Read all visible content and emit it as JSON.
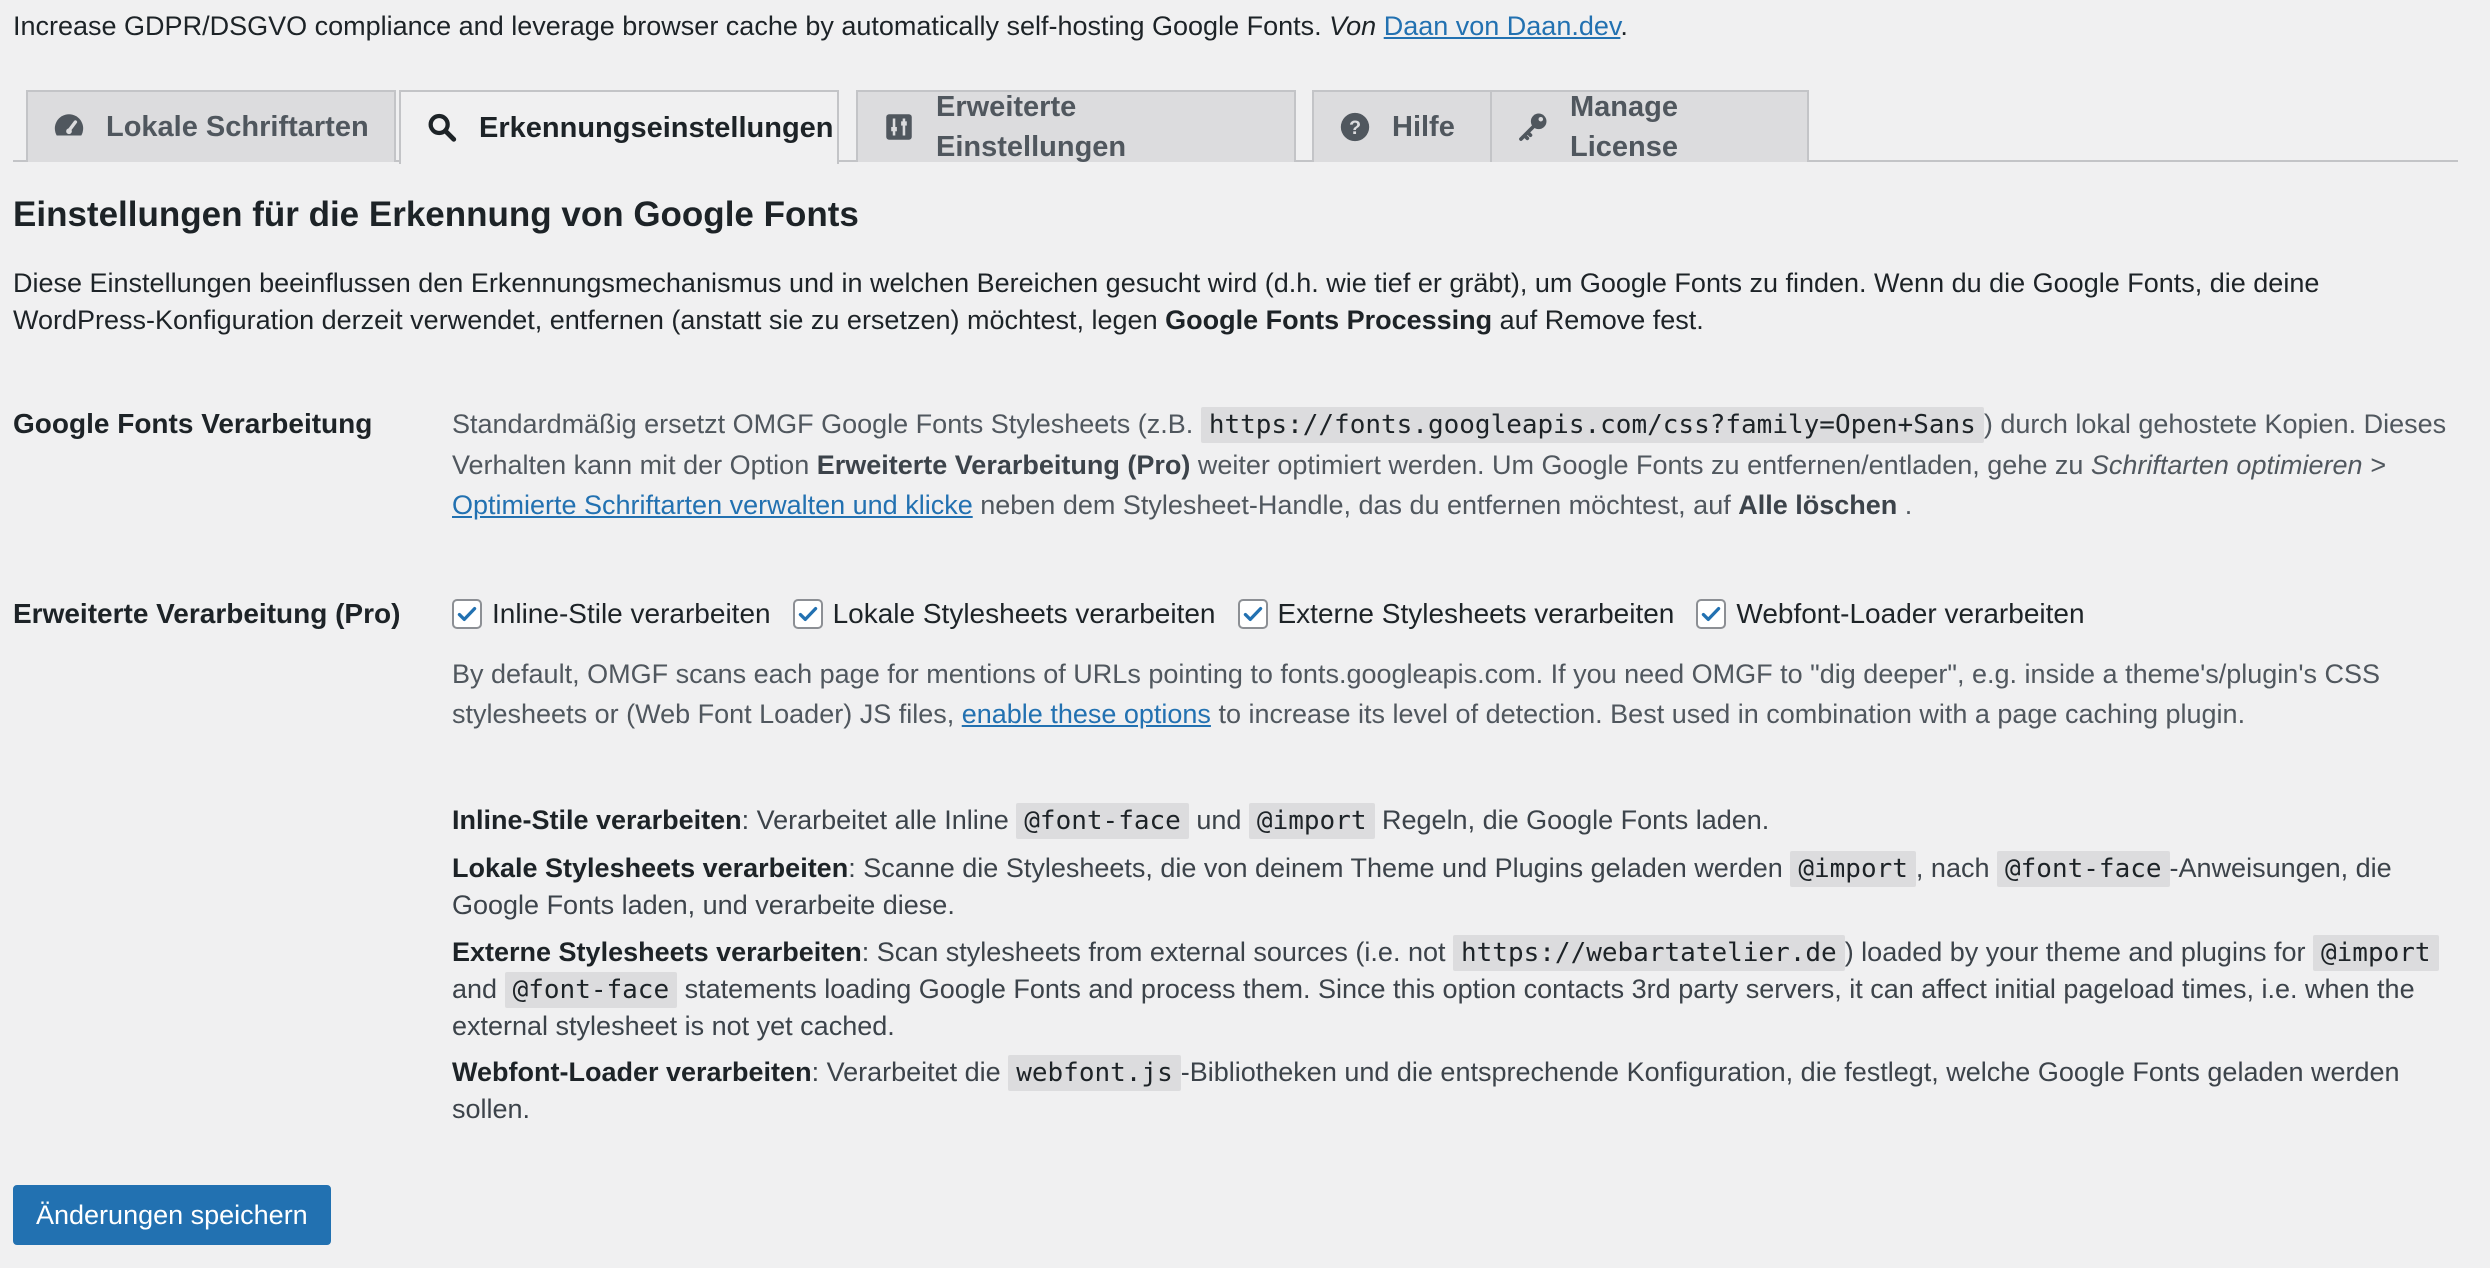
{
  "intro": {
    "text": "Increase GDPR/DSGVO compliance and leverage browser cache by automatically self-hosting Google Fonts.",
    "by": "Von",
    "author_link": "Daan von Daan.dev",
    "end": "."
  },
  "tabs": [
    {
      "label": "Lokale Schriftarten",
      "icon": "dashboard-icon",
      "active": false
    },
    {
      "label": "Erkennungseinstellungen",
      "icon": "search-icon",
      "active": true
    },
    {
      "label": "Erweiterte Einstellungen",
      "icon": "sliders-icon",
      "active": false
    },
    {
      "label": "Hilfe",
      "icon": "help-icon",
      "active": false
    },
    {
      "label": "Manage License",
      "icon": "key-icon",
      "active": false
    }
  ],
  "section": {
    "title": "Einstellungen für die Erkennung von Google Fonts",
    "desc_1": "Diese Einstellungen beeinflussen den Erkennungsmechanismus und in welchen Bereichen gesucht wird (d.h. wie tief er gräbt), um Google Fonts zu finden. Wenn du die Google Fonts, die deine WordPress-Konfiguration derzeit verwendet, entfernen (anstatt sie zu ersetzen) möchtest, legen",
    "desc_bold": "Google Fonts Processing",
    "desc_2": "auf Remove fest."
  },
  "gf_processing": {
    "label": "Google Fonts Verarbeitung",
    "t1": "Standardmäßig ersetzt OMGF Google Fonts Stylesheets (z.B.",
    "code": "https://fonts.googleapis.com/css?family=Open+Sans",
    "t2": ") durch lokal gehostete Kopien. Dieses Verhalten kann mit der Option",
    "b1": "Erweiterte Verarbeitung (Pro)",
    "t3": "weiter optimiert werden. Um Google Fonts zu entfernen/entladen, gehe zu",
    "i1": "Schriftarten optimieren >",
    "link": "Optimierte Schriftarten verwalten und klicke",
    "t4": "neben dem Stylesheet-Handle, das du entfernen möchtest, auf",
    "b2": "Alle löschen",
    "t5": "."
  },
  "advanced": {
    "label": "Erweiterte Verarbeitung (Pro)",
    "checkboxes": [
      {
        "label": "Inline-Stile verarbeiten",
        "checked": true
      },
      {
        "label": "Lokale Stylesheets verarbeiten",
        "checked": true
      },
      {
        "label": "Externe Stylesheets verarbeiten",
        "checked": true
      },
      {
        "label": "Webfont-Loader verarbeiten",
        "checked": true
      }
    ],
    "desc_1": "By default, OMGF scans each page for mentions of URLs pointing to fonts.googleapis.com. If you need OMGF to \"dig deeper\", e.g. inside a theme's/plugin's CSS stylesheets or (Web Font Loader) JS files,",
    "desc_link": "enable these options",
    "desc_2": "to increase its level of detection. Best used in combination with a page caching plugin.",
    "opt_inline": {
      "title": "Inline-Stile verarbeiten",
      "t1": ": Verarbeitet alle Inline",
      "c1": "@font-face",
      "t2": "und",
      "c2": "@import",
      "t3": "Regeln, die Google Fonts laden."
    },
    "opt_local": {
      "title": "Lokale Stylesheets verarbeiten",
      "t1": ": Scanne die Stylesheets, die von deinem Theme und Plugins geladen werden",
      "c1": "@import",
      "t2": ", nach",
      "c2": "@font-face",
      "t3": "-Anweisungen, die Google Fonts laden, und verarbeite diese."
    },
    "opt_external": {
      "title": "Externe Stylesheets verarbeiten",
      "t1": ": Scan stylesheets from external sources (i.e. not",
      "c1": "https://webartatelier.de",
      "t2": ") loaded by your theme and plugins for",
      "c2": "@import",
      "t3": "and",
      "c3": "@font-face",
      "t4": "statements loading Google Fonts and process them. Since this option contacts 3rd party servers, it can affect initial pageload times, i.e. when the external stylesheet is not yet cached."
    },
    "opt_webfont": {
      "title": "Webfont-Loader verarbeiten",
      "t1": ": Verarbeitet die",
      "c1": "webfont.js",
      "t2": "-Bibliotheken und die entsprechende Konfiguration, die festlegt, welche Google Fonts geladen werden sollen."
    }
  },
  "save_button": "Änderungen speichern",
  "colors": {
    "accent": "#2271b1",
    "background": "#f0f0f1",
    "tab_inactive": "#dcdcde"
  }
}
